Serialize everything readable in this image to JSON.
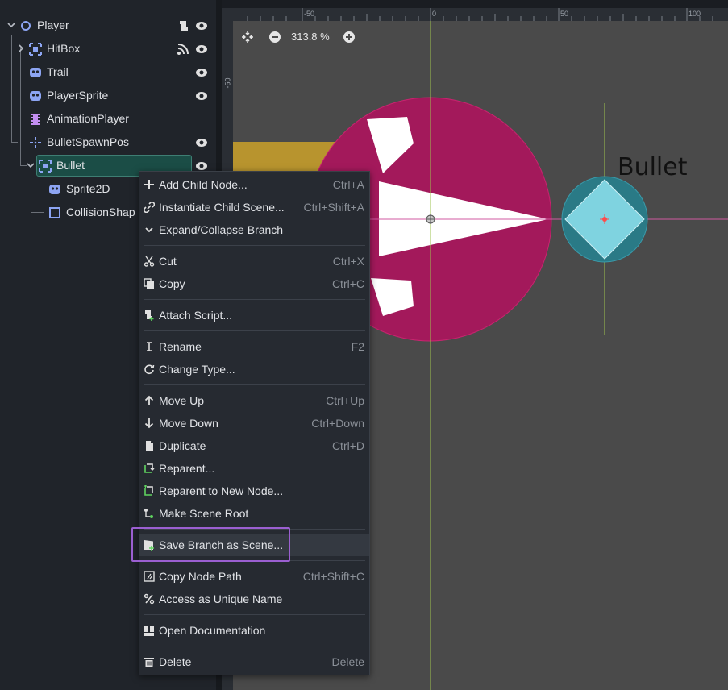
{
  "scene_tree": {
    "nodes": [
      {
        "label": "Player",
        "icon": "node2d-circle-icon",
        "color": "#8da5f3"
      },
      {
        "label": "HitBox",
        "icon": "area2d-icon",
        "color": "#8da5f3"
      },
      {
        "label": "Trail",
        "icon": "godot-sprite-icon",
        "color": "#8da5f3"
      },
      {
        "label": "PlayerSprite",
        "icon": "godot-sprite-icon",
        "color": "#8da5f3"
      },
      {
        "label": "AnimationPlayer",
        "icon": "animation-player-icon",
        "color": "#c38ef1"
      },
      {
        "label": "BulletSpawnPos",
        "icon": "marker2d-icon",
        "color": "#8da5f3"
      },
      {
        "label": "Bullet",
        "icon": "area2d-icon",
        "color": "#8da5f3"
      },
      {
        "label": "Sprite2D",
        "icon": "godot-sprite-icon",
        "color": "#8da5f3"
      },
      {
        "label": "CollisionShap",
        "icon": "collision-shape-icon",
        "color": "#8da5f3"
      }
    ]
  },
  "viewport": {
    "zoom_text": "313.8 %",
    "ruler_labels": [
      "-50",
      "0",
      "50",
      "100"
    ],
    "ruler_left_label": "-50",
    "bullet_label": "Bullet",
    "colors": {
      "player_circle": "#a3195b",
      "bullet_circle": "#2a7a86",
      "bullet_diamond": "#7fd3e0",
      "axis_green": "#9ec34f",
      "axis_pink": "#d05aa0"
    }
  },
  "context_menu": {
    "items": [
      {
        "label": "Add Child Node...",
        "shortcut": "Ctrl+A",
        "icon": "plus-icon"
      },
      {
        "label": "Instantiate Child Scene...",
        "shortcut": "Ctrl+Shift+A",
        "icon": "link-icon"
      },
      {
        "label": "Expand/Collapse Branch",
        "shortcut": "",
        "icon": "chevron-down-icon"
      },
      {
        "label": "Cut",
        "shortcut": "Ctrl+X",
        "icon": "scissors-icon"
      },
      {
        "label": "Copy",
        "shortcut": "Ctrl+C",
        "icon": "copy-icon"
      },
      {
        "label": "Attach Script...",
        "shortcut": "",
        "icon": "attach-script-icon"
      },
      {
        "label": "Rename",
        "shortcut": "F2",
        "icon": "rename-icon"
      },
      {
        "label": "Change Type...",
        "shortcut": "",
        "icon": "change-type-icon"
      },
      {
        "label": "Move Up",
        "shortcut": "Ctrl+Up",
        "icon": "arrow-up-icon"
      },
      {
        "label": "Move Down",
        "shortcut": "Ctrl+Down",
        "icon": "arrow-down-icon"
      },
      {
        "label": "Duplicate",
        "shortcut": "Ctrl+D",
        "icon": "duplicate-icon"
      },
      {
        "label": "Reparent...",
        "shortcut": "",
        "icon": "reparent-icon"
      },
      {
        "label": "Reparent to New Node...",
        "shortcut": "",
        "icon": "reparent-new-icon"
      },
      {
        "label": "Make Scene Root",
        "shortcut": "",
        "icon": "scene-root-icon"
      },
      {
        "label": "Save Branch as Scene...",
        "shortcut": "",
        "icon": "save-branch-icon"
      },
      {
        "label": "Copy Node Path",
        "shortcut": "Ctrl+Shift+C",
        "icon": "copy-path-icon"
      },
      {
        "label": "Access as Unique Name",
        "shortcut": "",
        "icon": "percent-icon"
      },
      {
        "label": "Open Documentation",
        "shortcut": "",
        "icon": "documentation-icon"
      },
      {
        "label": "Delete",
        "shortcut": "Delete",
        "icon": "trash-icon"
      }
    ]
  }
}
